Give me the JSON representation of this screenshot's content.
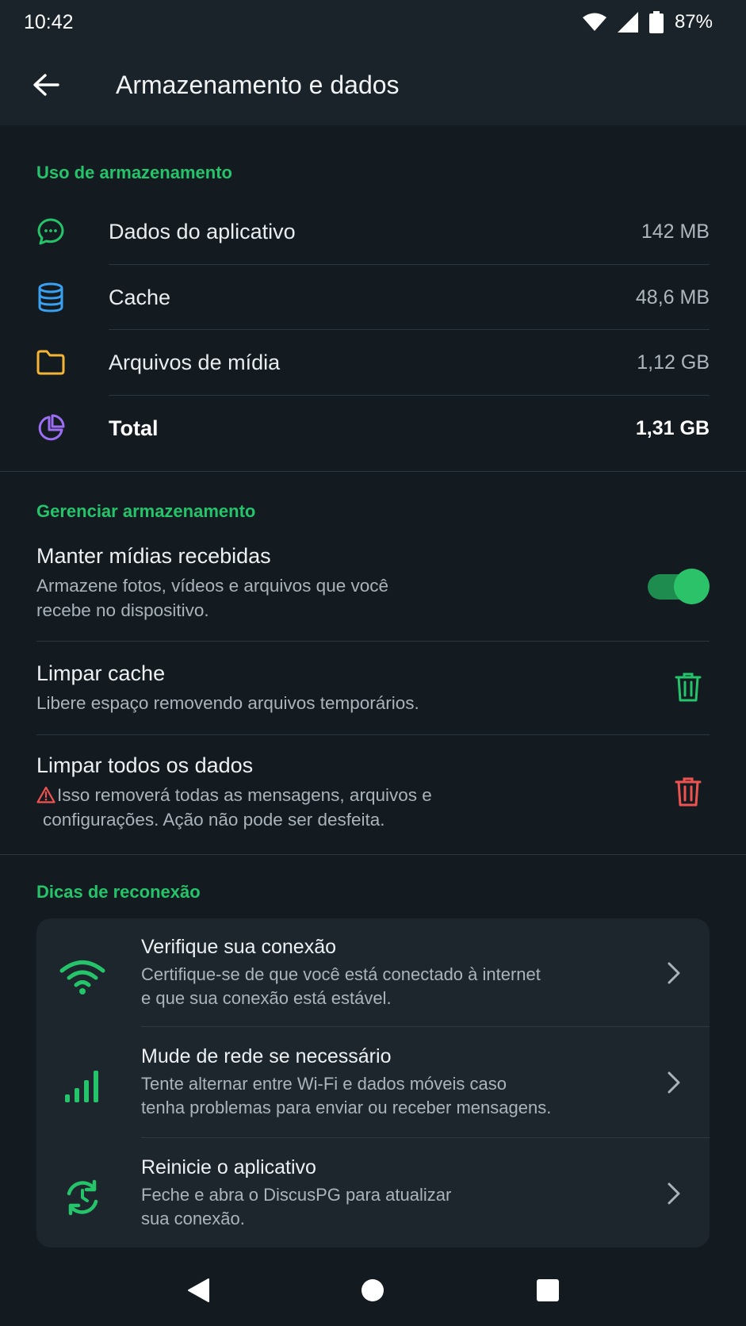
{
  "status": {
    "time": "10:42",
    "battery": "87%"
  },
  "appbar": {
    "title": "Armazenamento e dados"
  },
  "storage": {
    "section_title": "Uso de armazenamento",
    "rows": [
      {
        "label": "Dados do aplicativo",
        "value": "142 MB",
        "icon": "chat-icon",
        "color": "#25c46a"
      },
      {
        "label": "Cache",
        "value": "48,6 MB",
        "icon": "database-icon",
        "color": "#3aa0f0"
      },
      {
        "label": "Arquivos de mídia",
        "value": "1,12 GB",
        "icon": "folder-icon",
        "color": "#f3b533"
      },
      {
        "label": "Total",
        "value": "1,31 GB",
        "icon": "pie-chart-icon",
        "color": "#9b6ef3"
      }
    ]
  },
  "manage": {
    "section_title": "Gerenciar armazenamento",
    "keep_media": {
      "title": "Manter mídias recebidas",
      "desc1": "Armazene fotos, vídeos e arquivos que você",
      "desc2": "recebe no dispositivo.",
      "enabled": true
    },
    "clear_cache": {
      "title": "Limpar cache",
      "desc": "Libere espaço removendo arquivos temporários."
    },
    "clear_all": {
      "title": "Limpar todos os dados",
      "desc1": "Isso removerá todas as mensagens, arquivos e",
      "desc2": "configurações. Ação não pode ser desfeita."
    }
  },
  "tips": {
    "section_title": "Dicas de reconexão",
    "items": [
      {
        "title": "Verifique sua conexão",
        "desc1": "Certifique-se de que você está conectado à internet",
        "desc2": "e que sua conexão está estável.",
        "icon": "wifi-icon"
      },
      {
        "title": "Mude de rede se necessário",
        "desc1": "Tente alternar entre Wi-Fi e dados móveis caso",
        "desc2": "tenha problemas para enviar ou receber mensagens.",
        "icon": "signal-bars-icon"
      },
      {
        "title": "Reinicie o aplicativo",
        "desc1": "Feche e abra o DiscusPG para atualizar",
        "desc2": "sua conexão.",
        "icon": "restart-icon"
      }
    ]
  },
  "colors": {
    "accent": "#25c46a",
    "danger": "#ef5350",
    "background": "#131a20",
    "card": "#1d262d"
  }
}
